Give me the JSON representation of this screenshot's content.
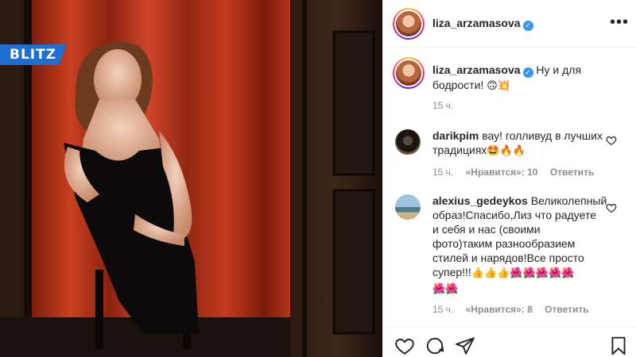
{
  "watermark": {
    "text": "BLITZ"
  },
  "post": {
    "author": "liza_arzamasova",
    "verified": true
  },
  "caption": {
    "author": "liza_arzamasova",
    "line1": "Ну и для",
    "line2": "бодрости! ",
    "emoji": "🙃💥",
    "time": "15 ч."
  },
  "comments": [
    {
      "author": "darikpim",
      "lines": [
        "вау! голливуд в лучших",
        "традициях"
      ],
      "emoji": "🤩🔥🔥",
      "time": "15 ч.",
      "likes": "«Нравится»: 10",
      "reply": "Ответить"
    },
    {
      "author": "alexius_gedeykos",
      "lines": [
        "Великолепный",
        "образ!Спасибо,Лиз что радуете",
        "и себя и нас (своими",
        "фото)таким разнообразием",
        "стилей и нарядов!Все просто",
        "супер!!!"
      ],
      "emoji_line1": "👍👍👍🌺🌺🌺🌺🌺",
      "emoji_line2": "🌺🌺",
      "time": "15 ч.",
      "likes": "«Нравится»: 8",
      "reply": "Ответить"
    }
  ],
  "icons": {
    "like": "heart-icon",
    "comment": "comment-icon",
    "share": "paper-plane-icon",
    "save": "bookmark-icon",
    "more": "more-dots-icon"
  },
  "colors": {
    "verified": "#3897f0",
    "watermark_bg": "#1f6fd1",
    "curtain": "#c1391c",
    "muted_text": "#8e8e8e"
  }
}
